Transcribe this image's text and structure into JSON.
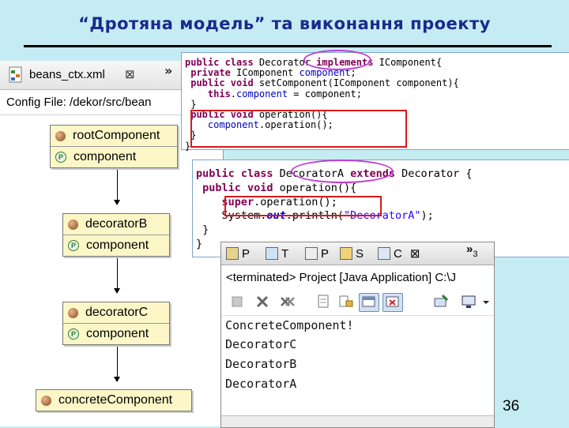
{
  "slide": {
    "title": "“Дротяна модель” та виконання проекту",
    "page_number": "36"
  },
  "beans_view": {
    "tab_label": "beans_ctx.xml",
    "tab_close": "⊠",
    "tab_more": "»",
    "config_file": "Config File: /dekor/src/bean",
    "beans": [
      {
        "name": "rootComponent",
        "property": "component"
      },
      {
        "name": "decoratorB",
        "property": "component"
      },
      {
        "name": "decoratorC",
        "property": "component"
      },
      {
        "name": "concreteComponent",
        "property": ""
      }
    ]
  },
  "code_decorator": {
    "lines": [
      {
        "parts": [
          {
            "t": "public class ",
            "c": "kw"
          },
          {
            "t": "Decorator ",
            "c": ""
          },
          {
            "t": "implements ",
            "c": "kw"
          },
          {
            "t": "IComponent{",
            "c": ""
          }
        ]
      },
      {
        "parts": [
          {
            "t": " private ",
            "c": "kw"
          },
          {
            "t": "IComponent ",
            "c": ""
          },
          {
            "t": "component",
            "c": "fld"
          },
          {
            "t": ";",
            "c": ""
          }
        ]
      },
      {
        "parts": [
          {
            "t": " public void ",
            "c": "kw"
          },
          {
            "t": "setComponent(IComponent component){",
            "c": ""
          }
        ]
      },
      {
        "parts": [
          {
            "t": "    this",
            "c": "kw"
          },
          {
            "t": ".",
            "c": ""
          },
          {
            "t": "component",
            "c": "fld"
          },
          {
            "t": " = component;",
            "c": ""
          }
        ]
      },
      {
        "parts": [
          {
            "t": " }",
            "c": ""
          }
        ]
      },
      {
        "parts": [
          {
            "t": " public void ",
            "c": "kw"
          },
          {
            "t": "operation(){",
            "c": ""
          }
        ]
      },
      {
        "parts": [
          {
            "t": "    component",
            "c": "fld"
          },
          {
            "t": ".operation();",
            "c": ""
          }
        ]
      },
      {
        "parts": [
          {
            "t": " }",
            "c": ""
          }
        ]
      },
      {
        "parts": [
          {
            "t": "}",
            "c": ""
          }
        ]
      }
    ]
  },
  "code_decorator_a": {
    "lines": [
      {
        "parts": [
          {
            "t": "public class ",
            "c": "kw"
          },
          {
            "t": "DecoratorA ",
            "c": ""
          },
          {
            "t": "extends ",
            "c": "kw"
          },
          {
            "t": "Decorator {",
            "c": ""
          }
        ]
      },
      {
        "parts": [
          {
            "t": " public void ",
            "c": "kw"
          },
          {
            "t": "operation(){",
            "c": ""
          }
        ]
      },
      {
        "parts": [
          {
            "t": "    super",
            "c": "kw"
          },
          {
            "t": ".operation();",
            "c": ""
          }
        ]
      },
      {
        "parts": [
          {
            "t": "    System.",
            "c": ""
          },
          {
            "t": "out",
            "c": "ital"
          },
          {
            "t": ".println(",
            "c": ""
          },
          {
            "t": "\"DecoratorA\"",
            "c": "str"
          },
          {
            "t": ");",
            "c": ""
          }
        ]
      },
      {
        "parts": [
          {
            "t": " }",
            "c": ""
          }
        ]
      },
      {
        "parts": [
          {
            "t": "}",
            "c": ""
          }
        ]
      }
    ]
  },
  "console": {
    "tabs": [
      "P",
      "T",
      "P",
      "S",
      "C"
    ],
    "tab_close": "⊠",
    "tab_more": "»",
    "tab_more_count": "3",
    "status": "<terminated> Project [Java Application] C:\\J",
    "output": [
      "ConcreteComponent!",
      "DecoratorC",
      "DecoratorB",
      "DecoratorA"
    ]
  },
  "colors": {
    "background": "#c6ecf3",
    "title": "#1a2a8c",
    "keyword": "#7f0055",
    "field": "#0000c0",
    "highlight_rect": "#d61a1a",
    "highlight_ellipse": "#c23bd3"
  }
}
